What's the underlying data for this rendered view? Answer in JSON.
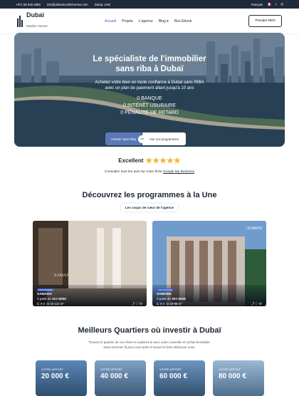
{
  "topbar": {
    "phone": "+971 58 636 4958",
    "email": "info@dubaimuslimhomes.com",
    "location": "Dubai, UAE",
    "language": "Français"
  },
  "logo": {
    "name": "Dubai",
    "tagline": "Muslim Homes"
  },
  "nav": {
    "items": [
      "Accueil",
      "Projets",
      "L'agence",
      "Blog",
      "Nos Ebook"
    ],
    "cta": "Prendre RDV"
  },
  "hero": {
    "title_line1": "Le spécialiste de l'immobilier",
    "title_line2": "sans riba à Dubaï",
    "sub_line1": "Achetez votre bien en toute confiance à Dubaï sans RIBA",
    "sub_line2": "avec un plan de paiement allant jusqu'à 10 ans",
    "points": [
      "0 BANQUE",
      "0 INTÉRÊT USURAIRE",
      "0 PÉNALITÉ DE RETARD"
    ],
    "btn_primary": "Acheter sans Riba",
    "or": "ou",
    "btn_secondary": "Voir nos programmes"
  },
  "review": {
    "label": "Excellent",
    "note_prefix": "Consultez tous les avis sur notre fiche",
    "note_link": "Google My Business"
  },
  "programs": {
    "title": "Découvrez les programmes à la Une",
    "pill": "Les coups de cœur de l'agence",
    "cards": [
      {
        "tag": "PROGRAMME",
        "name": "SAMANA",
        "price_prefix": "À partir de",
        "price": "317.500€",
        "beds": "0-3",
        "area": "33-124 m²"
      },
      {
        "tag": "PROGRAMME",
        "name": "SAMANA",
        "price_prefix": "À partir de",
        "price": "307.000€",
        "beds": "0-3",
        "area": "40-96 m²"
      }
    ],
    "card1_sign": "SAMANA",
    "card2_sign": "LEVANTE"
  },
  "quartiers": {
    "title": "Meilleurs Quartiers où investir à Dubaï",
    "line1": "Trouvez le quartier de vos rêves et explorez-le avec votre conseiller en achat immobilier.",
    "line2": "Nous sommes là pour vous aider à trouver le bien idéal pour vous.",
    "cards": [
      {
        "label": "VOTRE APPORT",
        "value": "20 000 €"
      },
      {
        "label": "VOTRE APPORT",
        "value": "40 000 €"
      },
      {
        "label": "VOTRE APPORT",
        "value": "60 000 €"
      },
      {
        "label": "VOTRE APPORT",
        "value": "80 000 €"
      }
    ]
  }
}
